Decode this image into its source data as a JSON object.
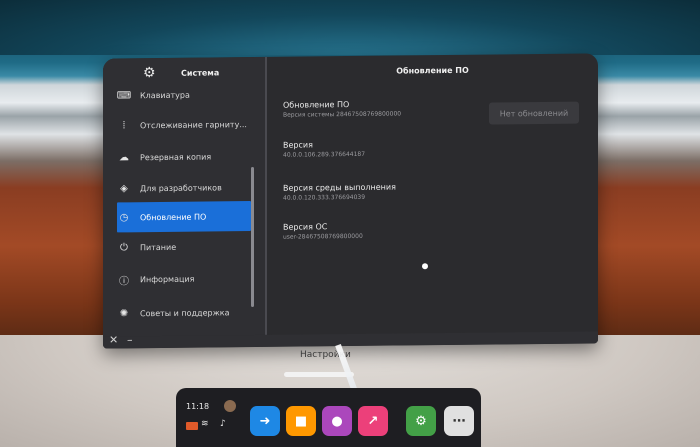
{
  "settings": {
    "sidebar_title": "Система",
    "items": [
      {
        "label": "Клавиатура",
        "icon": "keyboard-icon"
      },
      {
        "label": "Отслеживание гарниту...",
        "icon": "tracking-icon"
      },
      {
        "label": "Резервная копия",
        "icon": "cloud-icon"
      },
      {
        "label": "Для разработчиков",
        "icon": "cube-icon"
      },
      {
        "label": "Обновление ПО",
        "icon": "clock-icon"
      },
      {
        "label": "Питание",
        "icon": "power-icon"
      },
      {
        "label": "Информация",
        "icon": "info-icon"
      },
      {
        "label": "Советы и поддержка",
        "icon": "lightbulb-icon"
      }
    ]
  },
  "main": {
    "title": "Обновление ПО",
    "update": {
      "label": "Обновление ПО",
      "value": "Версия системы 28467508769800000"
    },
    "button": "Нет обновлений",
    "version": {
      "label": "Версия",
      "value": "40.0.0.106.289.376644187"
    },
    "runtime": {
      "label": "Версия среды выполнения",
      "value": "40.0.0.120.333.376694039"
    },
    "os": {
      "label": "Версия ОС",
      "value": "user-28467508769800000"
    }
  },
  "window_label": "Настройки",
  "dock": {
    "time": "11:18",
    "apps": [
      {
        "name": "store-app",
        "color": "#1e88e5",
        "glyph": "➜"
      },
      {
        "name": "shop-app",
        "color": "#ff9800",
        "glyph": "■"
      },
      {
        "name": "people-app",
        "color": "#ab47bc",
        "glyph": "●"
      },
      {
        "name": "share-app",
        "color": "#ec407a",
        "glyph": "↗"
      },
      {
        "name": "settings-app",
        "color": "#43a047",
        "glyph": "⚙"
      },
      {
        "name": "more-app",
        "color": "#e0e0e0",
        "glyph": "⋯"
      }
    ]
  }
}
